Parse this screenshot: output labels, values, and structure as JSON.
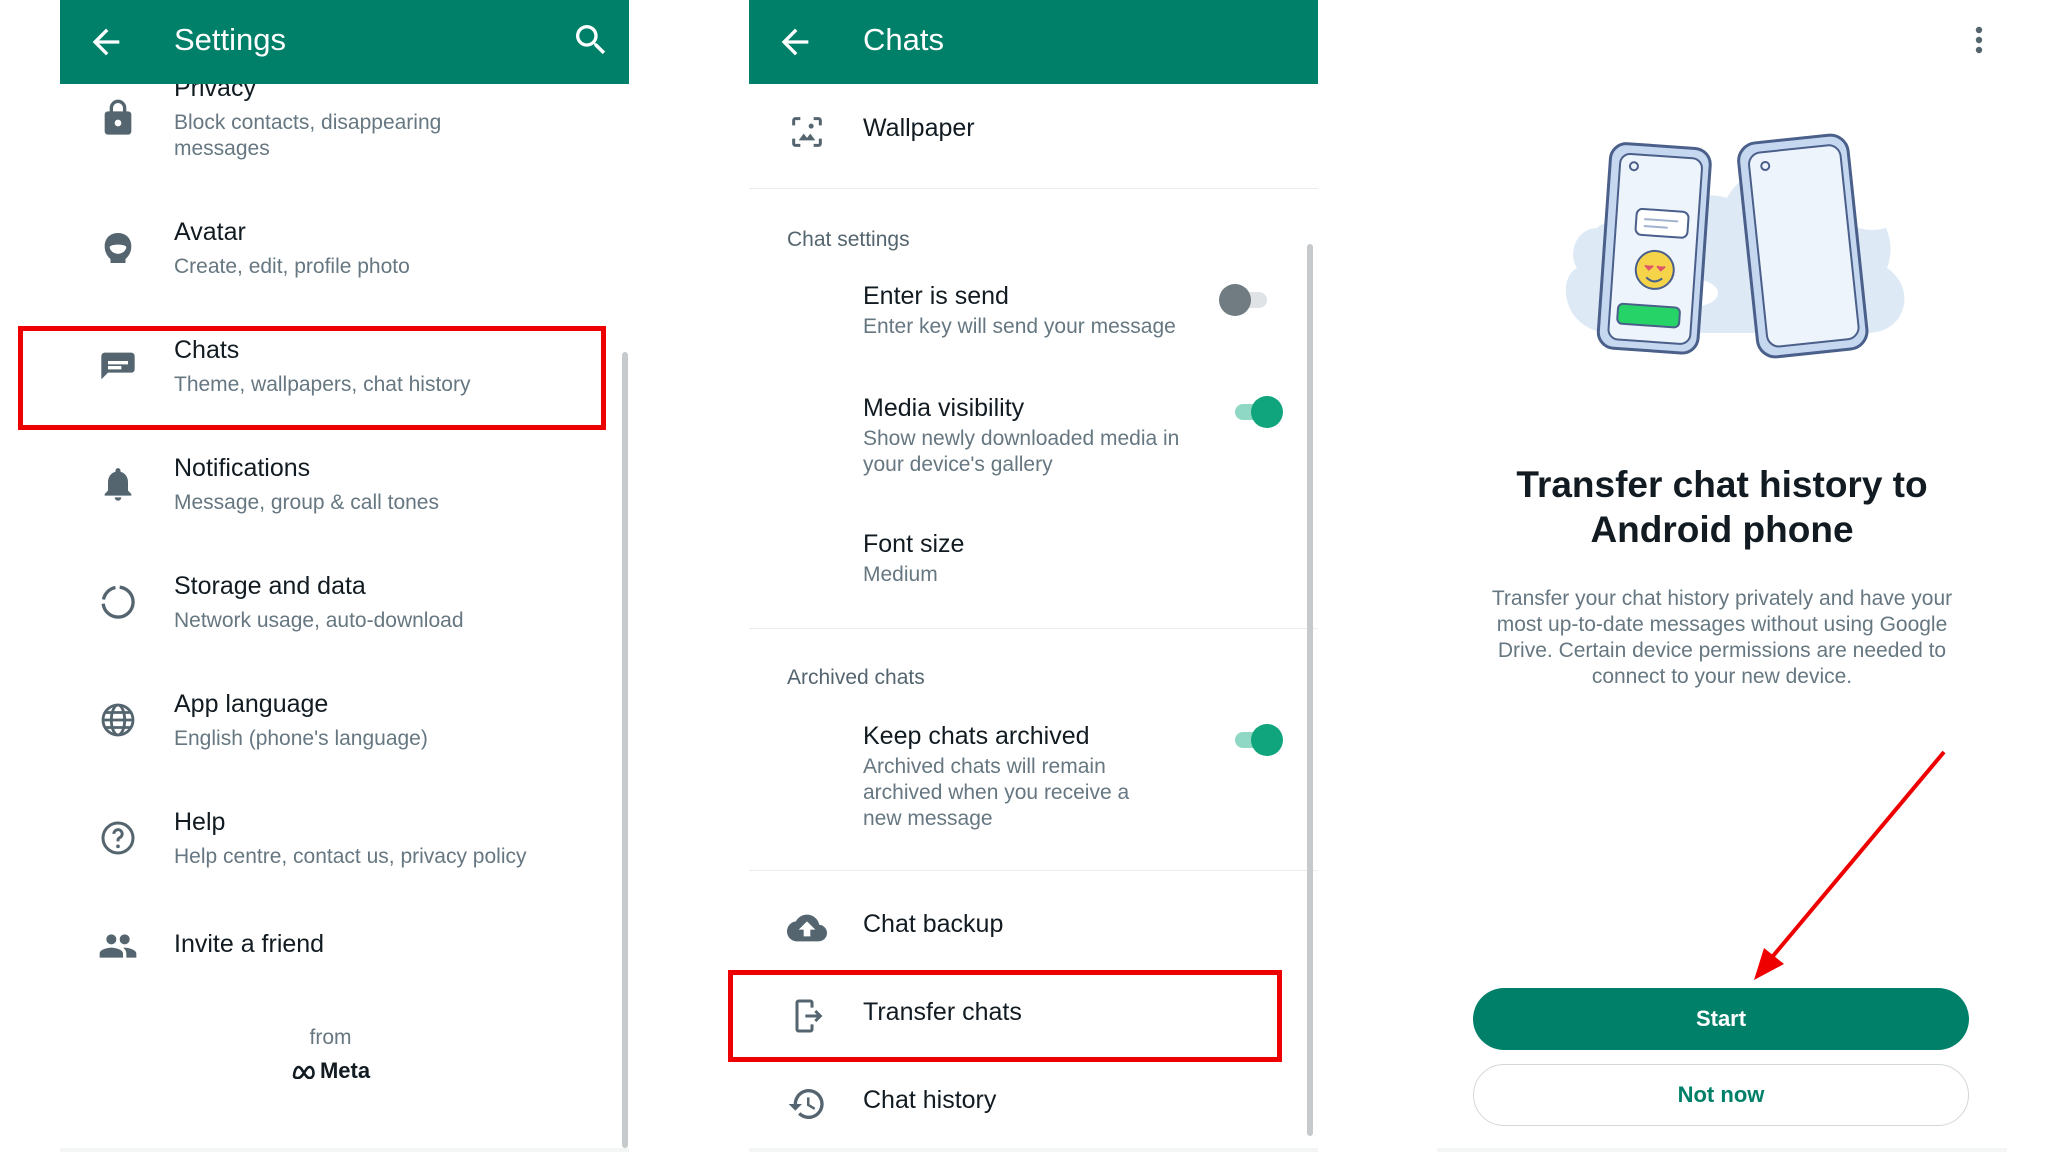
{
  "settings_screen": {
    "title": "Settings",
    "items": [
      {
        "title": "Privacy",
        "subtitle": "Block contacts, disappearing messages",
        "icon": "lock-icon"
      },
      {
        "title": "Avatar",
        "subtitle": "Create, edit, profile photo",
        "icon": "avatar-icon"
      },
      {
        "title": "Chats",
        "subtitle": "Theme, wallpapers, chat history",
        "icon": "chat-icon"
      },
      {
        "title": "Notifications",
        "subtitle": "Message, group & call tones",
        "icon": "bell-icon"
      },
      {
        "title": "Storage and data",
        "subtitle": "Network usage, auto-download",
        "icon": "storage-icon"
      },
      {
        "title": "App language",
        "subtitle": "English (phone's language)",
        "icon": "globe-icon"
      },
      {
        "title": "Help",
        "subtitle": "Help centre, contact us, privacy policy",
        "icon": "help-icon"
      },
      {
        "title": "Invite a friend",
        "icon": "people-icon"
      }
    ],
    "from_label": "from",
    "meta_label": "Meta"
  },
  "chats_screen": {
    "title": "Chats",
    "wallpaper_label": "Wallpaper",
    "chat_settings_header": "Chat settings",
    "enter_is_send": {
      "title": "Enter is send",
      "subtitle": "Enter key will send your message",
      "enabled": false
    },
    "media_visibility": {
      "title": "Media visibility",
      "subtitle": "Show newly downloaded media in your device's gallery",
      "enabled": true
    },
    "font_size": {
      "title": "Font size",
      "value": "Medium"
    },
    "archived_header": "Archived chats",
    "keep_archived": {
      "title": "Keep chats archived",
      "subtitle": "Archived chats will remain archived when you receive a new message",
      "enabled": true
    },
    "chat_backup_label": "Chat backup",
    "transfer_chats_label": "Transfer chats",
    "chat_history_label": "Chat history"
  },
  "transfer_screen": {
    "heading_line1": "Transfer chat history to",
    "heading_line2": "Android phone",
    "description": "Transfer your chat history privately and have your most up-to-date messages without using Google Drive. Certain device permissions are needed to connect to your new device.",
    "start_label": "Start",
    "not_now_label": "Not now"
  },
  "colors": {
    "brand": "#008069",
    "highlight": "#ee0000",
    "toggle_on": "#10a57d"
  }
}
